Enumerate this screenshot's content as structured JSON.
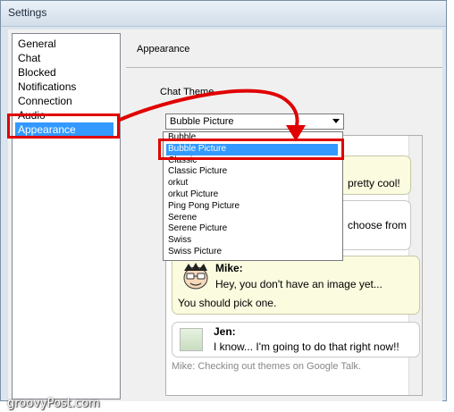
{
  "window": {
    "title": "Settings"
  },
  "nav": {
    "items": [
      {
        "label": "General"
      },
      {
        "label": "Chat"
      },
      {
        "label": "Blocked"
      },
      {
        "label": "Notifications"
      },
      {
        "label": "Connection"
      },
      {
        "label": "Audio"
      },
      {
        "label": "Appearance",
        "selected": true
      }
    ]
  },
  "panel": {
    "title": "Appearance",
    "section_label": "Chat Theme",
    "theme_select": {
      "value": "Bubble Picture",
      "options": [
        "Bubble",
        "Bubble Picture",
        "Classic",
        "Classic Picture",
        "orkut",
        "orkut Picture",
        "Ping Pong Picture",
        "Serene",
        "Serene Picture",
        "Swiss",
        "Swiss Picture"
      ],
      "highlighted": "Bubble Picture"
    }
  },
  "preview": {
    "peek_1": "pretty cool!",
    "peek_2": "choose from",
    "mike": {
      "name": "Mike:",
      "line1": "Hey, you don't have an image yet...",
      "line2": "You should pick one."
    },
    "jen": {
      "name": "Jen:",
      "line1": "I know... I'm going to do that right now!!"
    },
    "status": "Mike: Checking out themes on Google Talk."
  },
  "watermark": "groovyPost.com",
  "colors": {
    "selection": "#3399ff",
    "annotation_red": "#e00000",
    "bubble_yellow": "#fbfbe0"
  }
}
